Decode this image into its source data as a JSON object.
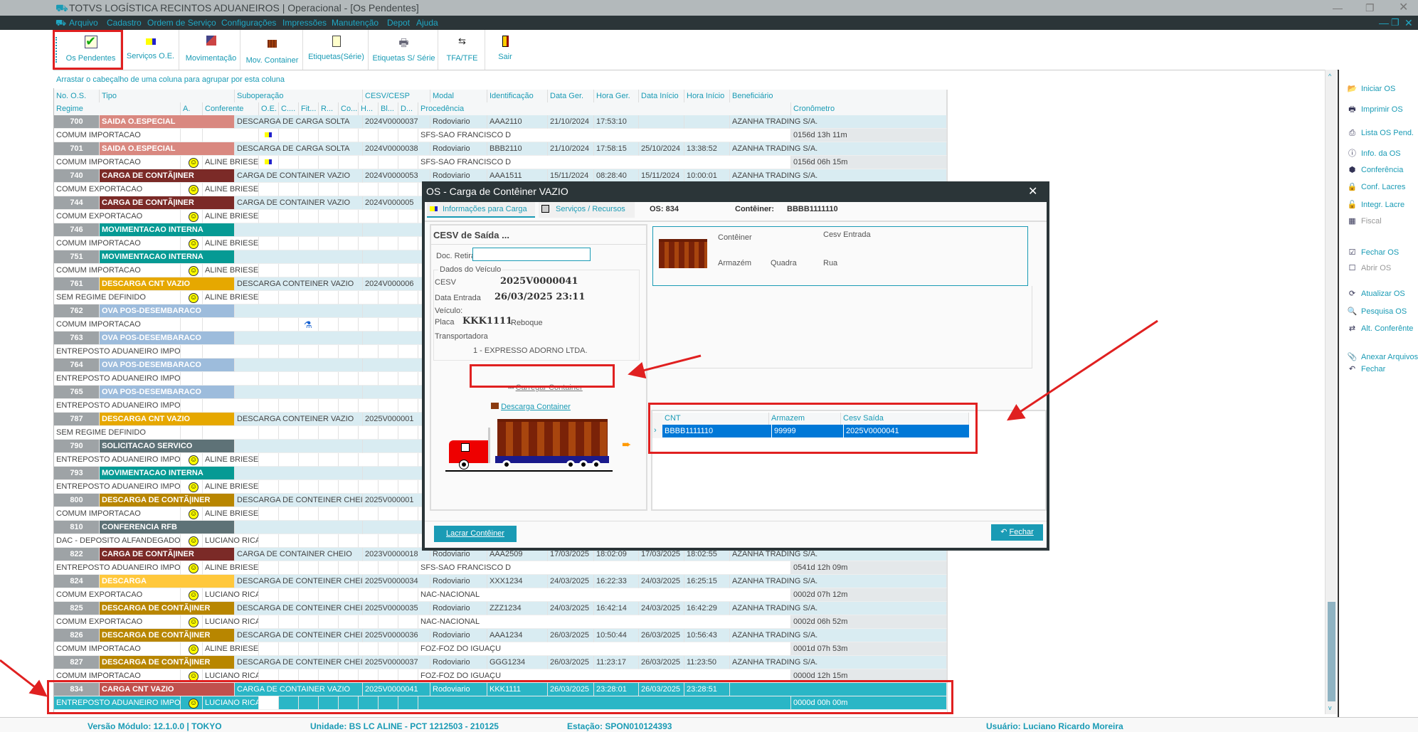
{
  "window": {
    "title": "TOTVS LOGÍSTICA RECINTOS ADUANEIROS | Operacional - [Os Pendentes]"
  },
  "menu": [
    "Arquivo",
    "Cadastro",
    "Ordem de Serviço",
    "Configurações",
    "Impressões",
    "Manutenção",
    "Depot",
    "Ajuda"
  ],
  "toolbar": [
    {
      "label": "Os Pendentes",
      "icon": "checklist-icon"
    },
    {
      "label": "Serviços O.E.",
      "icon": "truck-icon"
    },
    {
      "label": "Movimentação",
      "icon": "movement-icon"
    },
    {
      "label": "Mov. Container",
      "icon": "container-icon"
    },
    {
      "label": "Etiquetas(Série)",
      "icon": "labels-icon"
    },
    {
      "label": "Etiquetas S/ Série",
      "icon": "printer-icon"
    },
    {
      "label": "TFA/TFE",
      "icon": "transfer-icon"
    },
    {
      "label": "Sair",
      "icon": "exit-door-icon"
    }
  ],
  "grid": {
    "group_hint": "Arrastar o cabeçalho de uma coluna para agrupar por esta coluna",
    "headers1": [
      "No. O.S.",
      "Tipo",
      "Suboperação",
      "CESV/CESP",
      "Modal",
      "Identificação",
      "Data Ger.",
      "Hora Ger.",
      "Data Início",
      "Hora Início",
      "Beneficiário"
    ],
    "headers2": [
      "Regime",
      "A.",
      "Conferente",
      "O.E.",
      "C....",
      "Fit...",
      "R...",
      "Co...",
      "H...",
      "Bl...",
      "D...",
      "Procedência",
      "Cronômetro"
    ],
    "rows": [
      {
        "os": "700",
        "tipo": "SAIDA O.ESPECIAL",
        "color": "#d98880",
        "subop": "DESCARGA DE CARGA SOLTA",
        "cesv": "2024V0000037",
        "modal": "Rodoviario",
        "ident": "AAA2110",
        "data_ger": "21/10/2024",
        "hora_ger": "17:53:10",
        "data_ini": "",
        "hora_ini": "",
        "benef": "AZANHA TRADING S/A.",
        "regime": "COMUM IMPORTACAO",
        "smiley": false,
        "conf": "",
        "oe_icon": "truck-icon",
        "proc": "SFS-SAO FRANCISCO D",
        "crono": "0156d 13h 11m"
      },
      {
        "os": "701",
        "tipo": "SAIDA O.ESPECIAL",
        "color": "#d98880",
        "subop": "DESCARGA DE CARGA SOLTA",
        "cesv": "2024V0000038",
        "modal": "Rodoviario",
        "ident": "BBB2110",
        "data_ger": "21/10/2024",
        "hora_ger": "17:58:15",
        "data_ini": "25/10/2024",
        "hora_ini": "13:38:52",
        "benef": "AZANHA TRADING S/A.",
        "regime": "COMUM IMPORTACAO",
        "smiley": true,
        "conf": "ALINE BRIESEI",
        "oe_icon": "truck-icon",
        "proc": "SFS-SAO FRANCISCO D",
        "crono": "0156d 06h 15m"
      },
      {
        "os": "740",
        "tipo": "CARGA DE CONTÃ|INER",
        "color": "#7b2a27",
        "subop": "CARGA DE CONTAINER VAZIO",
        "cesv": "2024V0000053",
        "modal": "Rodoviario",
        "ident": "AAA1511",
        "data_ger": "15/11/2024",
        "hora_ger": "08:28:40",
        "data_ini": "15/11/2024",
        "hora_ini": "10:00:01",
        "benef": "AZANHA TRADING S/A.",
        "regime": "COMUM EXPORTACAO",
        "smiley": true,
        "conf": "ALINE BRIESEI"
      },
      {
        "os": "744",
        "tipo": "CARGA DE CONTÃ|INER",
        "color": "#7b2a27",
        "subop": "CARGA DE CONTAINER VAZIO",
        "cesv": "2024V000005",
        "regime": "COMUM EXPORTACAO",
        "smiley": true,
        "conf": "ALINE BRIESEI"
      },
      {
        "os": "746",
        "tipo": "MOVIMENTACAO INTERNA",
        "color": "#069a94",
        "regime": "COMUM IMPORTACAO",
        "smiley": true,
        "conf": "ALINE BRIESEI"
      },
      {
        "os": "751",
        "tipo": "MOVIMENTACAO INTERNA",
        "color": "#069a94",
        "regime": "COMUM IMPORTACAO",
        "smiley": true,
        "conf": "ALINE BRIESEI"
      },
      {
        "os": "761",
        "tipo": "DESCARGA CNT VAZIO",
        "color": "#e6a800",
        "subop": "DESCARGA CONTEINER VAZIO",
        "cesv": "2024V000006",
        "regime": "SEM REGIME DEFINIDO",
        "smiley": true,
        "conf": "ALINE BRIESEI"
      },
      {
        "os": "762",
        "tipo": "OVA POS-DESEMBARACO",
        "color": "#9dbcdc",
        "regime": "COMUM IMPORTACAO",
        "smiley": false,
        "fit_icon": "flask-icon"
      },
      {
        "os": "763",
        "tipo": "OVA POS-DESEMBARACO",
        "color": "#9dbcdc",
        "regime": "ENTREPOSTO ADUANEIRO IMPOR",
        "smiley": false
      },
      {
        "os": "764",
        "tipo": "OVA POS-DESEMBARACO",
        "color": "#9dbcdc",
        "regime": "ENTREPOSTO ADUANEIRO IMPOR",
        "smiley": false
      },
      {
        "os": "765",
        "tipo": "OVA POS-DESEMBARACO",
        "color": "#9dbcdc",
        "regime": "ENTREPOSTO ADUANEIRO IMPOR",
        "smiley": false
      },
      {
        "os": "787",
        "tipo": "DESCARGA CNT VAZIO",
        "color": "#e6a800",
        "subop": "DESCARGA CONTEINER VAZIO",
        "cesv": "2025V000001",
        "regime": "SEM REGIME DEFINIDO",
        "smiley": false
      },
      {
        "os": "790",
        "tipo": "SOLICITACAO SERVICO",
        "color": "#5e7277",
        "regime": "ENTREPOSTO ADUANEIRO IMPOR",
        "smiley": true,
        "conf": "ALINE BRIESEI"
      },
      {
        "os": "793",
        "tipo": "MOVIMENTACAO INTERNA",
        "color": "#069a94",
        "regime": "ENTREPOSTO ADUANEIRO IMPOR",
        "smiley": true,
        "conf": "ALINE BRIESEI"
      },
      {
        "os": "800",
        "tipo": "DESCARGA DE CONTÃ|INER",
        "color": "#b88600",
        "subop": "DESCARGA DE CONTEINER CHEIO",
        "cesv": "2025V000001",
        "regime": "COMUM IMPORTACAO",
        "smiley": true,
        "conf": "ALINE BRIESEI"
      },
      {
        "os": "810",
        "tipo": "CONFERENCIA RFB",
        "color": "#5e7277",
        "regime": "DAC - DEPOSITO ALFANDEGADO",
        "smiley": true,
        "conf": "LUCIANO RICA"
      },
      {
        "os": "822",
        "tipo": "CARGA DE CONTÃ|INER",
        "color": "#7b2a27",
        "subop": "CARGA DE CONTAINER CHEIO",
        "cesv": "2023V0000018",
        "modal": "Rodoviario",
        "ident": "AAA2509",
        "data_ger": "17/03/2025",
        "hora_ger": "18:02:09",
        "data_ini": "17/03/2025",
        "hora_ini": "18:02:55",
        "benef": "AZANHA TRADING S/A.",
        "regime": "ENTREPOSTO ADUANEIRO IMPOR",
        "smiley": true,
        "conf": "ALINE BRIESEI",
        "proc": "SFS-SAO FRANCISCO D",
        "crono": "0541d 12h 09m"
      },
      {
        "os": "824",
        "tipo": "DESCARGA",
        "color": "#ffc83c",
        "subop": "DESCARGA DE CONTEINER CHEIO",
        "cesv": "2025V0000034",
        "modal": "Rodoviario",
        "ident": "XXX1234",
        "data_ger": "24/03/2025",
        "hora_ger": "16:22:33",
        "data_ini": "24/03/2025",
        "hora_ini": "16:25:15",
        "benef": "AZANHA TRADING S/A.",
        "regime": "COMUM EXPORTACAO",
        "smiley": true,
        "conf": "LUCIANO RICA",
        "proc": "NAC-NACIONAL",
        "crono": "0002d 07h 12m"
      },
      {
        "os": "825",
        "tipo": "DESCARGA DE CONTÃ|INER",
        "color": "#b88600",
        "subop": "DESCARGA DE CONTEINER CHEIO",
        "cesv": "2025V0000035",
        "modal": "Rodoviario",
        "ident": "ZZZ1234",
        "data_ger": "24/03/2025",
        "hora_ger": "16:42:14",
        "data_ini": "24/03/2025",
        "hora_ini": "16:42:29",
        "benef": "AZANHA TRADING S/A.",
        "regime": "COMUM EXPORTACAO",
        "smiley": true,
        "conf": "LUCIANO RICA",
        "proc": "NAC-NACIONAL",
        "crono": "0002d 06h 52m"
      },
      {
        "os": "826",
        "tipo": "DESCARGA DE CONTÃ|INER",
        "color": "#b88600",
        "subop": "DESCARGA DE CONTEINER CHEIO",
        "cesv": "2025V0000036",
        "modal": "Rodoviario",
        "ident": "AAA1234",
        "data_ger": "26/03/2025",
        "hora_ger": "10:50:44",
        "data_ini": "26/03/2025",
        "hora_ini": "10:56:43",
        "benef": "AZANHA TRADING S/A.",
        "regime": "COMUM IMPORTACAO",
        "smiley": true,
        "conf": "ALINE BRIESEI",
        "proc": "FOZ-FOZ DO IGUAÇU",
        "crono": "0001d 07h 53m"
      },
      {
        "os": "827",
        "tipo": "DESCARGA DE CONTÃ|INER",
        "color": "#b88600",
        "subop": "DESCARGA DE CONTEINER CHEIO",
        "cesv": "2025V0000037",
        "modal": "Rodoviario",
        "ident": "GGG1234",
        "data_ger": "26/03/2025",
        "hora_ger": "11:23:17",
        "data_ini": "26/03/2025",
        "hora_ini": "11:23:50",
        "benef": "AZANHA TRADING S/A.",
        "regime": "COMUM IMPORTACAO",
        "smiley": true,
        "conf": "LUCIANO RICA",
        "proc": "FOZ-FOZ DO IGUAÇU",
        "crono": "0000d 12h 15m"
      },
      {
        "os": "834",
        "tipo": "CARGA CNT VAZIO",
        "color": "#c0504d",
        "subop": "CARGA DE CONTAINER VAZIO",
        "cesv": "2025V0000041",
        "modal": "Rodoviario",
        "ident": "KKK1111",
        "data_ger": "26/03/2025",
        "hora_ger": "23:28:01",
        "data_ini": "26/03/2025",
        "hora_ini": "23:28:51",
        "benef": "",
        "regime": "ENTREPOSTO ADUANEIRO IMPOR",
        "smiley": true,
        "conf": "LUCIANO RICA",
        "proc": "",
        "crono": "0000d 00h 00m",
        "selected": true
      }
    ]
  },
  "sidebar": [
    {
      "label": "Iniciar OS",
      "icon": "start-folder-icon"
    },
    {
      "label": "Imprimir OS",
      "icon": "printer-icon"
    },
    {
      "label": "Lista OS Pend.",
      "icon": "list-print-icon"
    },
    {
      "label": "Info. da OS",
      "icon": "info-icon"
    },
    {
      "label": "Conferência",
      "icon": "badge-icon"
    },
    {
      "label": "Conf. Lacres",
      "icon": "lock-icon"
    },
    {
      "label": "Integr. Lacre",
      "icon": "unlock-icon"
    },
    {
      "label": "Fiscal",
      "icon": "fiscal-icon",
      "disabled": true
    },
    {
      "label": "Fechar OS",
      "icon": "check-edit-icon"
    },
    {
      "label": "Abrir OS",
      "icon": "checkbox-icon",
      "disabled": true
    },
    {
      "label": "Atualizar OS",
      "icon": "refresh-icon"
    },
    {
      "label": "Pesquisa OS",
      "icon": "search-doc-icon"
    },
    {
      "label": "Alt. Conferênte",
      "icon": "swap-user-icon"
    },
    {
      "label": "Anexar Arquivos",
      "icon": "paperclip-icon"
    },
    {
      "label": "Fechar",
      "icon": "undo-icon"
    }
  ],
  "status": {
    "version": "Versão Módulo:  12.1.0.0  |  TOKYO",
    "unit": "Unidade: BS LC ALINE - PCT 1212503 - 210125",
    "station": "Estação: SPON010124393",
    "user": "Usuário: Luciano Ricardo Moreira"
  },
  "dialog": {
    "title": "OS - Carga de Contêiner VAZIO",
    "tabs": [
      "Informações para Carga",
      "Serviços / Recursos"
    ],
    "os_label": "OS: 834",
    "container_label": "Contêiner:",
    "container_value": "BBBB1111110",
    "section_title": "CESV de Saída ...",
    "doc_retirada_label": "Doc. Retirada",
    "doc_retirada_value": "",
    "vehicle_group": "Dados do Veículo",
    "cesv_label": "CESV",
    "cesv_value": "2025V0000041",
    "data_entrada_label": "Data Entrada",
    "data_entrada_value": "26/03/2025 23:11",
    "veiculo_label": "Veículo:",
    "placa_label": "Placa",
    "placa_value": "KKK1111",
    "reboque_label": "Reboque",
    "transportadora_label": "Transportadora",
    "transportadora_value": "1 - EXPRESSO ADORNO LTDA.",
    "carregar_label": "Carregar Container",
    "descarga_label": "Descarga Container",
    "info": {
      "conteiner": "Contêiner",
      "cesv_entrada": "Cesv Entrada",
      "armazem": "Armazém",
      "quadra": "Quadra",
      "rua": "Rua"
    },
    "table": {
      "headers": [
        "CNT",
        "Armazem",
        "Cesv Saída"
      ],
      "rows": [
        [
          "BBBB1111110",
          "99999",
          "2025V0000041"
        ]
      ]
    },
    "lacrar_label": "Lacrar Contêiner",
    "fechar_label": "Fechar"
  }
}
